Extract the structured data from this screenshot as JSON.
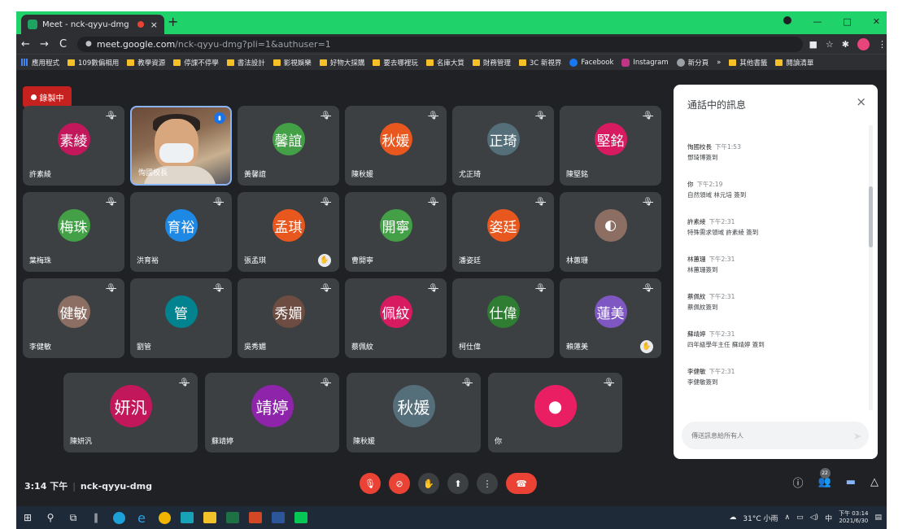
{
  "browser": {
    "tab_title": "Meet - nck-qyyu-dmg",
    "tab_close": "×",
    "new_tab": "+",
    "url_host": "meet.google.com",
    "url_path": "/nck-qyyu-dmg?pli=1&authuser=1",
    "back": "←",
    "forward": "→",
    "reload": "C"
  },
  "bookmarks": [
    {
      "label": "應用程式",
      "icon": "apps"
    },
    {
      "label": "109數偏相用",
      "icon": "folder"
    },
    {
      "label": "教學資源",
      "icon": "folder"
    },
    {
      "label": "停課不停學",
      "icon": "folder"
    },
    {
      "label": "書法設計",
      "icon": "folder"
    },
    {
      "label": "影視娛樂",
      "icon": "folder"
    },
    {
      "label": "好物大採購",
      "icon": "folder"
    },
    {
      "label": "要去哪裡玩",
      "icon": "folder"
    },
    {
      "label": "名庫大質",
      "icon": "folder"
    },
    {
      "label": "財務管理",
      "icon": "folder"
    },
    {
      "label": "3C 新視界",
      "icon": "folder"
    },
    {
      "label": "Facebook",
      "icon": "facebook"
    },
    {
      "label": "Instagram",
      "icon": "instagram"
    },
    {
      "label": "新分頁",
      "icon": "globe"
    },
    {
      "label": "»",
      "icon": "none"
    },
    {
      "label": "其他書籤",
      "icon": "folder"
    },
    {
      "label": "閱讀清單",
      "icon": "folder"
    }
  ],
  "meet": {
    "recording_label": "錄製中",
    "time": "3:14 下午",
    "meeting_code": "nck-qyyu-dmg",
    "people_count": "22"
  },
  "tiles": [
    {
      "avatar": "素綾",
      "name": "許素綾",
      "color": "#c2185b",
      "video": false,
      "hand": false
    },
    {
      "avatar": "",
      "name": "恂國校長",
      "color": "#000000",
      "video": true,
      "hand": false
    },
    {
      "avatar": "馨誼",
      "name": "黃馨誼",
      "color": "#43a047",
      "video": false,
      "hand": false
    },
    {
      "avatar": "秋媛",
      "name": "陳秋媛",
      "color": "#e8571e",
      "video": false,
      "hand": false
    },
    {
      "avatar": "正琦",
      "name": "尤正琦",
      "color": "#546e7a",
      "video": false,
      "hand": false
    },
    {
      "avatar": "堅銘",
      "name": "陳堅銘",
      "color": "#d81b60",
      "video": false,
      "hand": false
    },
    {
      "avatar": "梅珠",
      "name": "葉梅珠",
      "color": "#43a047",
      "video": false,
      "hand": false
    },
    {
      "avatar": "育裕",
      "name": "洪育裕",
      "color": "#1e88e5",
      "video": false,
      "hand": false
    },
    {
      "avatar": "孟琪",
      "name": "張孟琪",
      "color": "#e8571e",
      "video": false,
      "hand": true
    },
    {
      "avatar": "開寧",
      "name": "曹開寧",
      "color": "#43a047",
      "video": false,
      "hand": false
    },
    {
      "avatar": "姿廷",
      "name": "潘姿廷",
      "color": "#e8571e",
      "video": false,
      "hand": false
    },
    {
      "avatar": "",
      "name": "林蕙珊",
      "color": "#8d6e63",
      "video": false,
      "hand": false
    },
    {
      "avatar": "健敏",
      "name": "李健敏",
      "color": "#8d6e63",
      "video": false,
      "hand": false
    },
    {
      "avatar": "管",
      "name": "劉管",
      "color": "#00838f",
      "video": false,
      "hand": false
    },
    {
      "avatar": "秀媚",
      "name": "吳秀媚",
      "color": "#6d4c41",
      "video": false,
      "hand": false
    },
    {
      "avatar": "佩紋",
      "name": "蔡佩紋",
      "color": "#d81b60",
      "video": false,
      "hand": false
    },
    {
      "avatar": "仕偉",
      "name": "柯仕偉",
      "color": "#2e7d32",
      "video": false,
      "hand": false
    },
    {
      "avatar": "蓮美",
      "name": "賴蓮美",
      "color": "#7e57c2",
      "video": false,
      "hand": true
    },
    {
      "avatar": "妍汎",
      "name": "陳妍汎",
      "color": "#c2185b",
      "video": false,
      "hand": false
    },
    {
      "avatar": "靖婷",
      "name": "蘇靖婷",
      "color": "#8e24aa",
      "video": false,
      "hand": false
    },
    {
      "avatar": "秋媛",
      "name": "陳秋媛",
      "color": "#546e7a",
      "video": false,
      "hand": false
    },
    {
      "avatar": "",
      "name": "你",
      "color": "#e91e63",
      "video": false,
      "hand": false
    }
  ],
  "chat": {
    "title": "通話中的訊息",
    "close": "×",
    "input_placeholder": "傳送訊息給所有人",
    "messages": [
      {
        "sender": "恂國校長",
        "time": "下午1:53",
        "text": "鄧琦博簽到"
      },
      {
        "sender": "你",
        "time": "下午2:19",
        "text": "自然領域 林元培 簽到"
      },
      {
        "sender": "許素綾",
        "time": "下午2:31",
        "text": "特殊需求領域 許素綾 簽到"
      },
      {
        "sender": "林蕙珊",
        "time": "下午2:31",
        "text": "林蕙珊簽到"
      },
      {
        "sender": "蔡佩紋",
        "time": "下午2:31",
        "text": "蔡佩紋簽到"
      },
      {
        "sender": "蘇靖婷",
        "time": "下午2:31",
        "text": "四年級學年主任 蘇靖婷 簽到"
      },
      {
        "sender": "李健敏",
        "time": "下午2:31",
        "text": "李健敏簽到"
      }
    ]
  },
  "taskbar": {
    "weather": "31°C 小雨",
    "ime": "中",
    "clock_time": "下午 03:14",
    "clock_date": "2021/6/30"
  }
}
